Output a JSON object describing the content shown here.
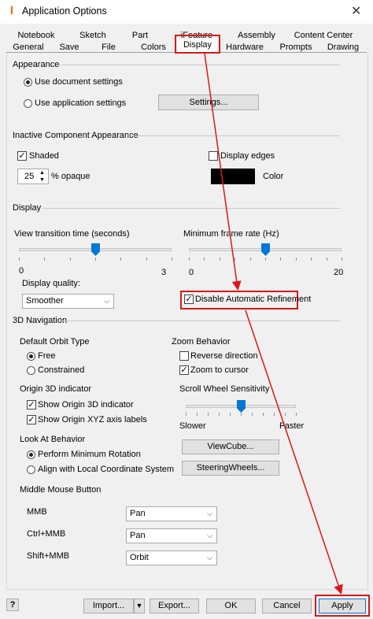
{
  "window": {
    "title": "Application Options",
    "close": "✕",
    "app_icon": "I"
  },
  "tabs_row1": [
    "Notebook",
    "Sketch",
    "Part",
    "iFeature",
    "Assembly",
    "Content Center"
  ],
  "tabs_row2": [
    "General",
    "Save",
    "File",
    "Colors",
    "Display",
    "Hardware",
    "Prompts",
    "Drawing"
  ],
  "active_tab": "Display",
  "appearance": {
    "title": "Appearance",
    "opt_document": "Use document settings",
    "opt_application": "Use application settings",
    "selected": "Use document settings",
    "settings_button": "Settings..."
  },
  "inactive": {
    "title": "Inactive Component Appearance",
    "shaded": "Shaded",
    "shaded_checked": true,
    "opaque_value": "25",
    "opaque_label": "% opaque",
    "display_edges": "Display edges",
    "display_edges_checked": false,
    "color_label": "Color",
    "color_value": "#000000"
  },
  "display": {
    "title": "Display",
    "view_transition_label": "View transition time (seconds)",
    "view_min": "0",
    "view_max": "3",
    "view_value": 1.5,
    "min_frame_label": "Minimum frame rate (Hz)",
    "frame_min": "0",
    "frame_max": "20",
    "frame_value": 10,
    "quality_label": "Display quality:",
    "quality_value": "Smoother",
    "disable_refinement": "Disable Automatic Refinement",
    "disable_refinement_checked": true
  },
  "nav3d": {
    "title": "3D Navigation",
    "orbit_title": "Default Orbit Type",
    "orbit_free": "Free",
    "orbit_constrained": "Constrained",
    "orbit_selected": "Free",
    "zoom_title": "Zoom Behavior",
    "reverse_direction": "Reverse direction",
    "reverse_checked": false,
    "zoom_to_cursor": "Zoom to cursor",
    "zoom_to_cursor_checked": true,
    "origin_title": "Origin 3D indicator",
    "show_origin_indicator": "Show Origin 3D indicator",
    "show_origin_checked": true,
    "show_xyz": "Show Origin XYZ axis labels",
    "show_xyz_checked": true,
    "scroll_title": "Scroll Wheel Sensitivity",
    "scroll_slower": "Slower",
    "scroll_faster": "Faster",
    "scroll_value": 0.5,
    "lookat_title": "Look At Behavior",
    "lookat_min_rotation": "Perform Minimum Rotation",
    "lookat_align": "Align with Local Coordinate System",
    "lookat_selected": "Perform Minimum Rotation",
    "viewcube_button": "ViewCube...",
    "steeringwheels_button": "SteeringWheels...",
    "mmb_title": "Middle Mouse Button",
    "mmb_rows": [
      {
        "label": "MMB",
        "value": "Pan"
      },
      {
        "label": "Ctrl+MMB",
        "value": "Pan"
      },
      {
        "label": "Shift+MMB",
        "value": "Orbit"
      }
    ]
  },
  "footer": {
    "help": "?",
    "import": "Import...",
    "export": "Export...",
    "ok": "OK",
    "cancel": "Cancel",
    "apply": "Apply"
  },
  "colors": {
    "accent": "#0078d7",
    "highlight_red": "#d7191c"
  }
}
